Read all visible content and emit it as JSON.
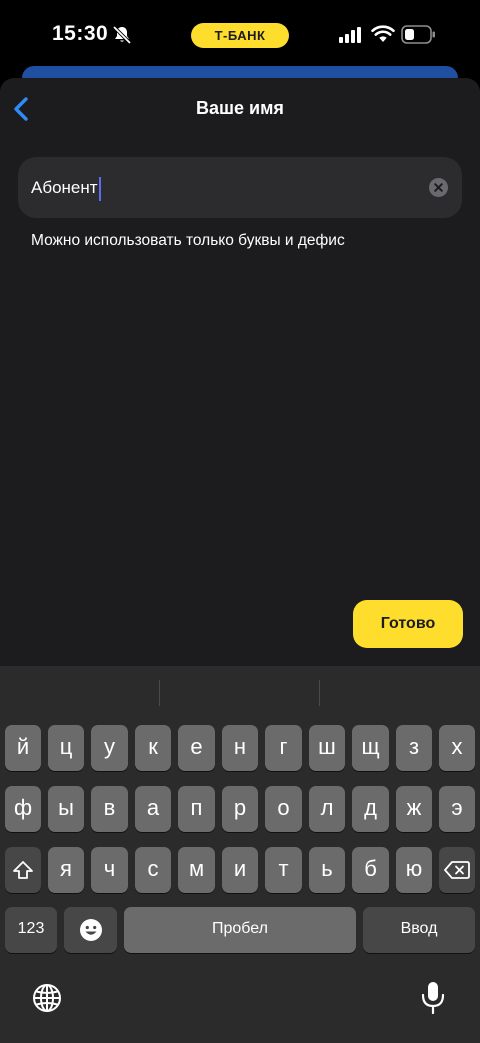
{
  "status_bar": {
    "time": "15:30",
    "brand": "Т-БАНК",
    "icons": [
      "bell-off-icon",
      "signal-icon",
      "wifi-icon",
      "battery-icon"
    ]
  },
  "header": {
    "title": "Ваше имя",
    "back_icon": "chevron-left-icon"
  },
  "name_field": {
    "value": "Абонент",
    "clear_icon": "clear-icon"
  },
  "hint": "Можно использовать только буквы и дефис",
  "done_button": {
    "label": "Готово"
  },
  "keyboard": {
    "row1": [
      "й",
      "ц",
      "у",
      "к",
      "е",
      "н",
      "г",
      "ш",
      "щ",
      "з",
      "х"
    ],
    "row2": [
      "ф",
      "ы",
      "в",
      "а",
      "п",
      "р",
      "о",
      "л",
      "д",
      "ж",
      "э"
    ],
    "row3": [
      "я",
      "ч",
      "с",
      "м",
      "и",
      "т",
      "ь",
      "б",
      "ю"
    ],
    "shift_icon": "shift-icon",
    "backspace_icon": "backspace-icon",
    "numbers_label": "123",
    "emoji_icon": "emoji-icon",
    "space_label": "Пробел",
    "return_label": "Ввод",
    "globe_icon": "globe-icon",
    "mic_icon": "microphone-icon"
  },
  "colors": {
    "accent_yellow": "#ffdd2d",
    "link_blue": "#2f8cf7",
    "sheet_background": "#1c1c1e",
    "field_background": "#2c2c2e",
    "keyboard_background": "#2b2b2b",
    "key_light": "#6b6b6b",
    "key_dark": "#474747"
  }
}
